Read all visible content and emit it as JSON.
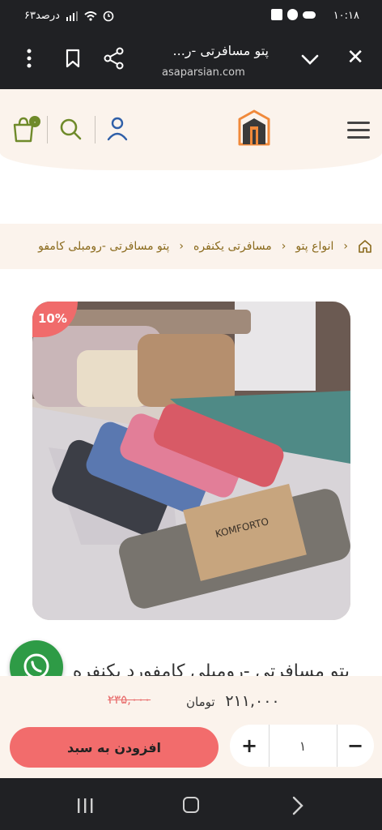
{
  "status_bar": {
    "time": "۱۰:۱۸",
    "battery": "۶۳درصد"
  },
  "browser": {
    "page_title": "پتو مسافرتی -ر...",
    "url": "asaparsian.com",
    "icons": [
      "close-icon",
      "chevron-down-icon",
      "share-icon",
      "bookmark-icon",
      "more-vert-icon"
    ]
  },
  "header": {
    "icons": [
      "menu-icon",
      "logo",
      "user-icon",
      "search-icon",
      "cart-icon"
    ],
    "cart_badge": "۰"
  },
  "breadcrumb": {
    "items": [
      "انواع پتو",
      "مسافرتی یکنفره",
      "پتو مسافرتی -رومبلی کامفو"
    ]
  },
  "product": {
    "discount_badge": "10%",
    "image_label": "KOMFORTO",
    "title": "پتو مسافرتی -رومبلی کامفورد یکنفره",
    "price": "۲۱۱,۰۰۰",
    "currency": "تومان",
    "old_price": "۲۳۵,۰۰۰"
  },
  "cart_controls": {
    "add_to_cart": "افزودن به سبد",
    "quantity": "۱",
    "plus": "+",
    "minus": "−"
  },
  "colors": {
    "accent_red": "#f26c6c",
    "header_bg": "#fbf3ec",
    "breadcrumb_text": "#8a6a1c",
    "whatsapp_green": "#2e9b46"
  }
}
